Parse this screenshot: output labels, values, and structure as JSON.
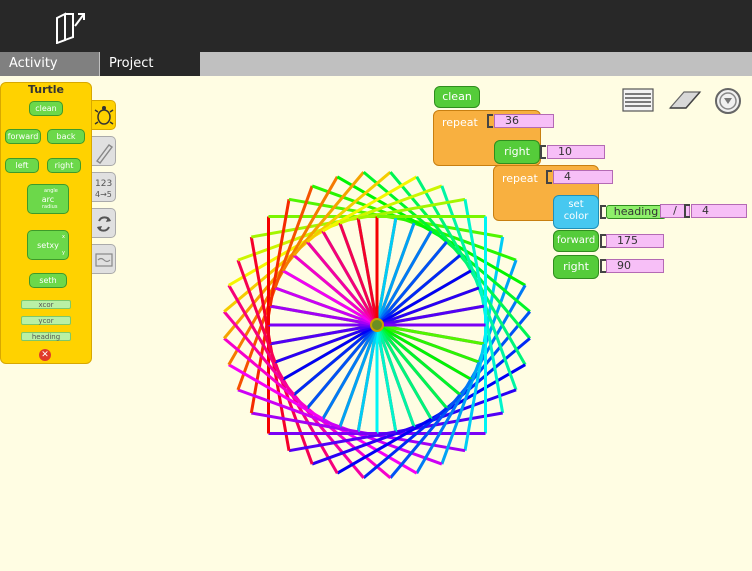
{
  "toolbar": {
    "tabs": [
      {
        "label": "Activity"
      },
      {
        "label": "Project"
      }
    ]
  },
  "palette": {
    "title": "Turtle",
    "blocks": [
      "clean",
      "forward",
      "back",
      "left",
      "right",
      "arc",
      "setxy",
      "seth"
    ],
    "arc_args": [
      "angle",
      "radius"
    ],
    "setxy_args": [
      "x",
      "y"
    ],
    "values": [
      "xcor",
      "ycor",
      "heading"
    ]
  },
  "script": {
    "clean": "clean",
    "repeat1": {
      "label": "repeat",
      "value": "36"
    },
    "right1": {
      "label": "right",
      "value": "10"
    },
    "repeat2": {
      "label": "repeat",
      "value": "4"
    },
    "setcolor": {
      "line1": "set",
      "line2": "color"
    },
    "heading": "heading",
    "divide": "/",
    "divisor": "4",
    "forward": {
      "label": "forward",
      "value": "175"
    },
    "right2": {
      "label": "right",
      "value": "90"
    }
  },
  "colors": {
    "block_green": "#55cc3a",
    "block_orange": "#f8b040",
    "block_cyan": "#47c8f0",
    "number_pink": "#f7bff7",
    "palette_yellow": "#ffd200",
    "canvas": "#fffde3"
  },
  "icons": [
    "activity-share-icon",
    "turtle-icon",
    "pen-icon",
    "numbers-icon",
    "flow-icon",
    "sensors-icon",
    "hide-blocks-icon",
    "eraser-icon",
    "run-icon"
  ]
}
